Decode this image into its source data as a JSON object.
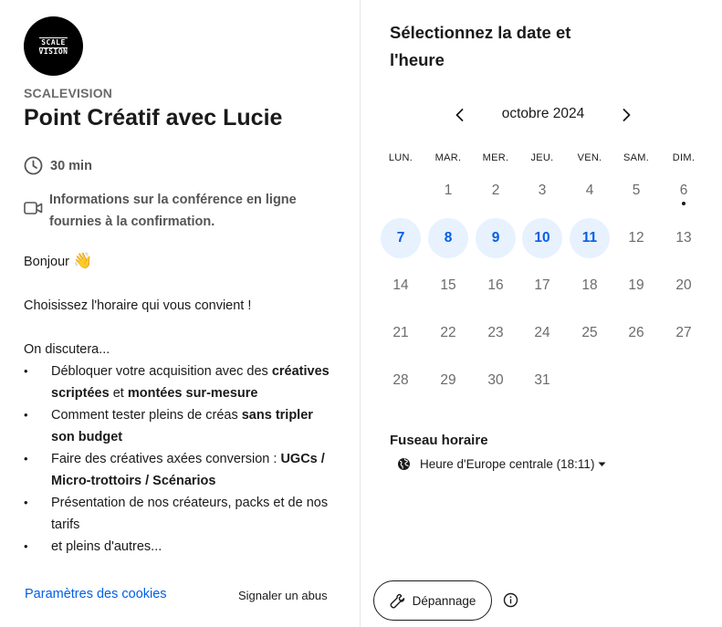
{
  "organizer": {
    "logo_text_line1": "SCALE",
    "logo_text_line2": "VISION",
    "company": "SCALEVISION",
    "event_title": "Point Créatif avec Lucie"
  },
  "meta": {
    "duration": "30 min",
    "duration_icon": "clock-icon",
    "conference": "Informations sur la conférence en ligne fournies à la confirmation.",
    "conference_icon": "video-camera-icon"
  },
  "description": {
    "greeting": "Bonjour",
    "greeting_emoji": "👋",
    "intro": "Choisissez l'horaire qui vous convient !",
    "list_intro": "On discutera...",
    "bullets": [
      {
        "pre": "Débloquer votre acquisition avec des ",
        "b1": "créatives scriptées",
        "mid": " et ",
        "b2": "montées sur-mesure"
      },
      {
        "pre": "Comment tester pleins de créas ",
        "b1": "sans tripler son budget"
      },
      {
        "pre": "Faire des créatives axées conversion : ",
        "b1": "UGCs / Micro-trottoirs / Scénarios"
      },
      {
        "pre": "Présentation de nos créateurs, packs et de nos tarifs"
      },
      {
        "pre": "et pleins d'autres..."
      }
    ]
  },
  "footer": {
    "cookies": "Paramètres des cookies",
    "report": "Signaler un abus"
  },
  "calendar": {
    "heading": "Sélectionnez la date et l'heure",
    "month_label": "octobre 2024",
    "prev_icon": "chevron-left-icon",
    "next_icon": "chevron-right-icon",
    "weekdays": [
      "LUN.",
      "MAR.",
      "MER.",
      "JEU.",
      "VEN.",
      "SAM.",
      "DIM."
    ],
    "first_weekday_index": 1,
    "days_in_month": 31,
    "available_days": [
      7,
      8,
      9,
      10,
      11
    ],
    "today": 6
  },
  "timezone": {
    "label": "Fuseau horaire",
    "value": "Heure d'Europe centrale (18:11)",
    "icon": "globe-icon"
  },
  "troubleshoot": {
    "label": "Dépannage",
    "icon": "wrench-icon",
    "info_icon": "info-icon"
  },
  "colors": {
    "accent": "#0060e6",
    "available_bg": "#e8f1fe",
    "muted": "#6b6b6b"
  }
}
